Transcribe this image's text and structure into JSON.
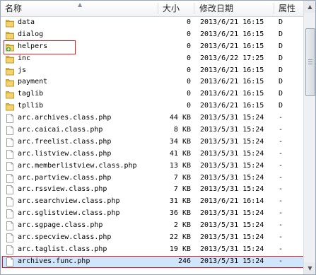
{
  "columns": {
    "name": "名称",
    "size": "大小",
    "date": "修改日期",
    "attr": "属性"
  },
  "files": [
    {
      "name": "data",
      "size": "0",
      "date": "2013/6/21 16:15",
      "attr": "D",
      "icon": "folder"
    },
    {
      "name": "dialog",
      "size": "0",
      "date": "2013/6/21 16:15",
      "attr": "D",
      "icon": "folder"
    },
    {
      "name": "helpers",
      "size": "0",
      "date": "2013/6/21 16:15",
      "attr": "D",
      "icon": "folder-add"
    },
    {
      "name": "inc",
      "size": "0",
      "date": "2013/6/22 17:25",
      "attr": "D",
      "icon": "folder"
    },
    {
      "name": "js",
      "size": "0",
      "date": "2013/6/21 16:15",
      "attr": "D",
      "icon": "folder"
    },
    {
      "name": "payment",
      "size": "0",
      "date": "2013/6/21 16:15",
      "attr": "D",
      "icon": "folder"
    },
    {
      "name": "taglib",
      "size": "0",
      "date": "2013/6/21 16:15",
      "attr": "D",
      "icon": "folder"
    },
    {
      "name": "tpllib",
      "size": "0",
      "date": "2013/6/21 16:15",
      "attr": "D",
      "icon": "folder"
    },
    {
      "name": "arc.archives.class.php",
      "size": "44 KB",
      "date": "2013/5/31 15:24",
      "attr": "-",
      "icon": "file"
    },
    {
      "name": "arc.caicai.class.php",
      "size": "8 KB",
      "date": "2013/5/31 15:24",
      "attr": "-",
      "icon": "file"
    },
    {
      "name": "arc.freelist.class.php",
      "size": "34 KB",
      "date": "2013/5/31 15:24",
      "attr": "-",
      "icon": "file"
    },
    {
      "name": "arc.listview.class.php",
      "size": "41 KB",
      "date": "2013/5/31 15:24",
      "attr": "-",
      "icon": "file"
    },
    {
      "name": "arc.memberlistview.class.php",
      "size": "13 KB",
      "date": "2013/5/31 15:24",
      "attr": "-",
      "icon": "file"
    },
    {
      "name": "arc.partview.class.php",
      "size": "7 KB",
      "date": "2013/5/31 15:24",
      "attr": "-",
      "icon": "file"
    },
    {
      "name": "arc.rssview.class.php",
      "size": "7 KB",
      "date": "2013/5/31 15:24",
      "attr": "-",
      "icon": "file"
    },
    {
      "name": "arc.searchview.class.php",
      "size": "31 KB",
      "date": "2013/6/21 16:14",
      "attr": "-",
      "icon": "file"
    },
    {
      "name": "arc.sglistview.class.php",
      "size": "36 KB",
      "date": "2013/5/31 15:24",
      "attr": "-",
      "icon": "file"
    },
    {
      "name": "arc.sgpage.class.php",
      "size": "2 KB",
      "date": "2013/5/31 15:24",
      "attr": "-",
      "icon": "file"
    },
    {
      "name": "arc.specview.class.php",
      "size": "22 KB",
      "date": "2013/5/31 15:24",
      "attr": "-",
      "icon": "file"
    },
    {
      "name": "arc.taglist.class.php",
      "size": "19 KB",
      "date": "2013/5/31 15:24",
      "attr": "-",
      "icon": "file"
    },
    {
      "name": "archives.func.php",
      "size": "246",
      "date": "2013/5/31 15:24",
      "attr": "-",
      "icon": "file"
    }
  ],
  "highlight_color": "#d8222b",
  "selection_color": "#cfe6fb"
}
